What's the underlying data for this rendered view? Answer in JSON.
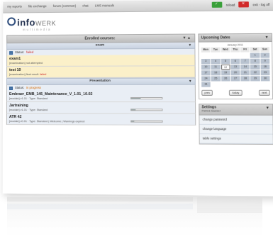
{
  "nav": {
    "items": [
      "my reports",
      "file exchange",
      "forum (common)",
      "chat",
      "LMS manuals"
    ],
    "reload_label": "reload",
    "logout_label": "exit - log off"
  },
  "logo": {
    "text_bold": "info",
    "text_light": "WERK",
    "sub": "multimedia"
  },
  "enrolled": {
    "title": "Enrolled courses:",
    "controls": "▼ ▲"
  },
  "groups": [
    {
      "title": "exam",
      "status_label": "Status:",
      "status_value": "failed",
      "courses": [
        {
          "name": "exam1",
          "meta_type": "[examination]",
          "meta_text": "not attempted"
        },
        {
          "name": "test 10",
          "meta_type": "[examination]",
          "meta_text": "final result:",
          "meta_result": "failed"
        }
      ]
    },
    {
      "title": "Presentation",
      "status_label": "Status:",
      "status_value": "in progress",
      "courses": [
        {
          "name": "Embraer_EMB_145_Maintenance_V_1.01_10.02",
          "meta_type": "[module]",
          "meta_text": "v1.01 · Type: Standard",
          "progress": 0.3
        },
        {
          "name": "Jartraining",
          "meta_type": "[module]",
          "meta_text": "v1.01 · Type: Standard",
          "progress": 0.15
        },
        {
          "name": "ATR 42",
          "meta_type": "[module]",
          "meta_text": "v0.01 · Type: Standard | Welcome | Warnings expired",
          "progress": 0.1
        }
      ]
    }
  ],
  "calendar": {
    "title": "Upcoming Dates",
    "month": "January 2011",
    "dow": [
      "Mon",
      "Tue",
      "Wed",
      "Thu",
      "Fri",
      "Sat",
      "Sun"
    ],
    "weeks": [
      [
        "",
        "",
        "",
        "",
        "",
        "1",
        "2"
      ],
      [
        "3",
        "4",
        "5",
        "6",
        "7",
        "8",
        "9"
      ],
      [
        "10",
        "11",
        "12",
        "13",
        "14",
        "15",
        "16"
      ],
      [
        "17",
        "18",
        "19",
        "20",
        "21",
        "22",
        "23"
      ],
      [
        "24",
        "25",
        "26",
        "27",
        "28",
        "29",
        "30"
      ],
      [
        "31",
        "",
        "",
        "",
        "",
        "",
        ""
      ]
    ],
    "today": "12",
    "buttons": [
      "prev",
      "today",
      "next"
    ]
  },
  "settings": {
    "title": "Settings",
    "user": "Patrick Saelzer",
    "items": [
      "change password",
      "change language",
      "table settings"
    ]
  }
}
